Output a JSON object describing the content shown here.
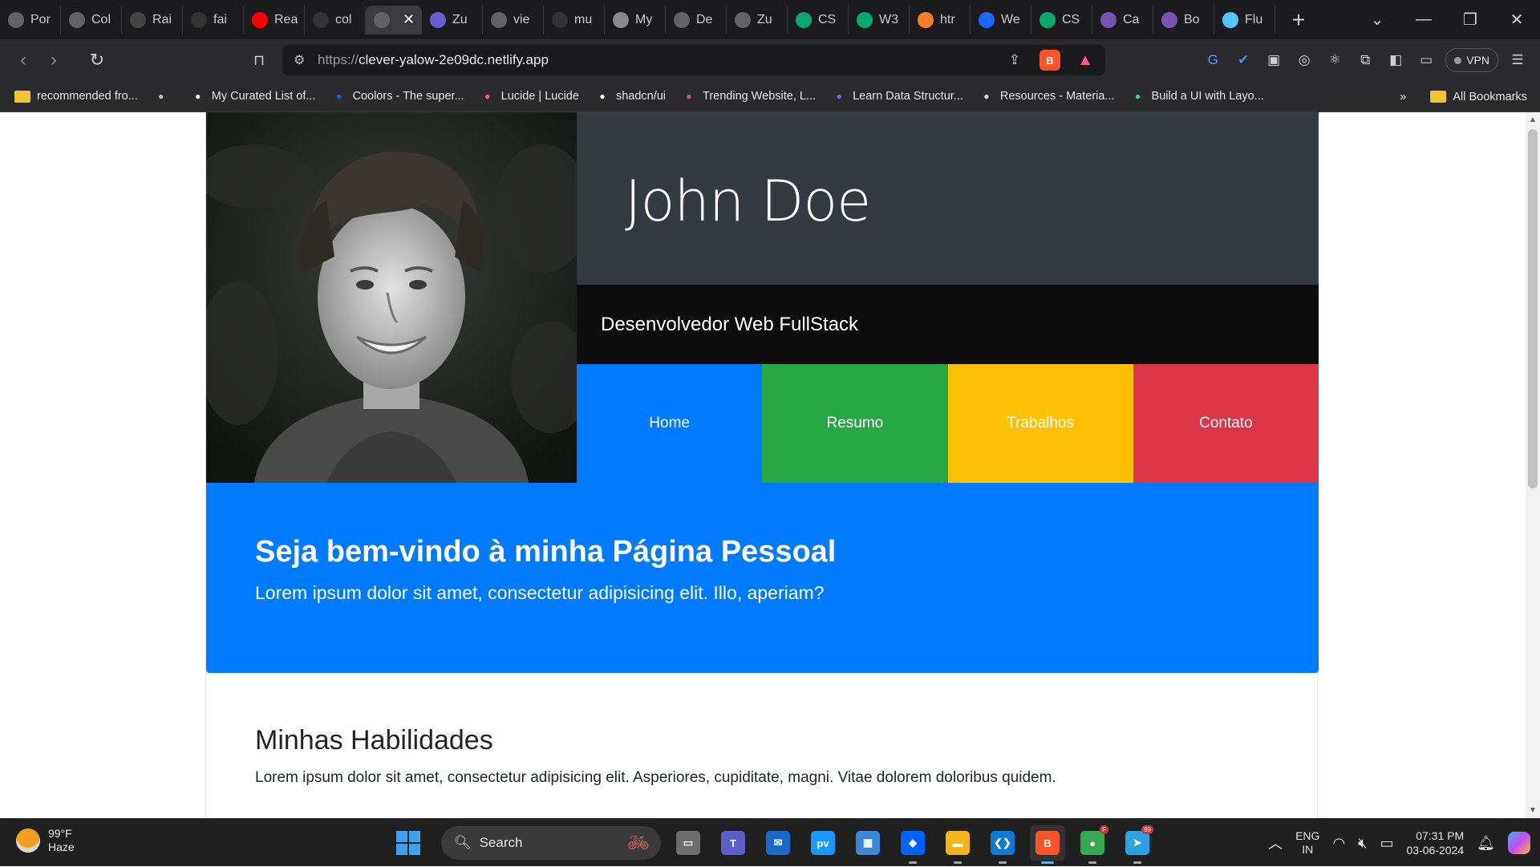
{
  "browser": {
    "tabs": [
      {
        "label": "Por",
        "icon": "globe-icon",
        "color": "#5f6368"
      },
      {
        "label": "Col",
        "icon": "globe-icon",
        "color": "#5f6368"
      },
      {
        "label": "Rai",
        "icon": "openai-icon",
        "color": "#444444"
      },
      {
        "label": "fai",
        "icon": "github-icon",
        "color": "#333333"
      },
      {
        "label": "Rea",
        "icon": "youtube-icon",
        "color": "#ff0000"
      },
      {
        "label": "col",
        "icon": "github-icon",
        "color": "#333333"
      },
      {
        "label": "",
        "icon": "globe-icon",
        "color": "#5f6368",
        "active": true
      },
      {
        "label": "Zu",
        "icon": "zustand-icon",
        "color": "#6b5bd2"
      },
      {
        "label": "vie",
        "icon": "globe-icon",
        "color": "#5f6368"
      },
      {
        "label": "mu",
        "icon": "github-icon",
        "color": "#333333"
      },
      {
        "label": "My",
        "icon": "notion-icon",
        "color": "#888888"
      },
      {
        "label": "De",
        "icon": "globe-icon",
        "color": "#5f6368"
      },
      {
        "label": "Zu",
        "icon": "globe-icon",
        "color": "#5f6368"
      },
      {
        "label": "CS",
        "icon": "w3schools-icon",
        "color": "#04aa6d"
      },
      {
        "label": "W3",
        "icon": "w3schools-icon",
        "color": "#04aa6d"
      },
      {
        "label": "htr",
        "icon": "stackoverflow-icon",
        "color": "#f48024"
      },
      {
        "label": "We",
        "icon": "behance-icon",
        "color": "#1769ff"
      },
      {
        "label": "CS",
        "icon": "w3schools-icon",
        "color": "#04aa6d"
      },
      {
        "label": "Ca",
        "icon": "bootstrap-icon",
        "color": "#7952b3"
      },
      {
        "label": "Bo",
        "icon": "bootstrap-icon",
        "color": "#7952b3"
      },
      {
        "label": "Flu",
        "icon": "flutter-icon",
        "color": "#54c5f8"
      }
    ],
    "url_scheme": "https://",
    "url_host": "clever-yalow-2e09dc.netlify.app",
    "vpn_label": "VPN",
    "bookmarks": [
      {
        "label": "recommended fro...",
        "icon": "folder-icon"
      },
      {
        "label": "",
        "icon": "globe-icon"
      },
      {
        "label": "My Curated List of...",
        "icon": "medium-icon"
      },
      {
        "label": "Coolors - The super...",
        "icon": "coolors-icon"
      },
      {
        "label": "Lucide | Lucide",
        "icon": "lucide-icon"
      },
      {
        "label": "shadcn/ui",
        "icon": "shadcn-icon"
      },
      {
        "label": "Trending Website, L...",
        "icon": "dribbble-icon"
      },
      {
        "label": "Learn Data Structur...",
        "icon": "bookmark-icon"
      },
      {
        "label": "Resources - Materia...",
        "icon": "page-icon"
      },
      {
        "label": "Build a UI with Layo...",
        "icon": "android-icon"
      }
    ],
    "bookmarks_overflow": "»",
    "all_bookmarks": "All Bookmarks"
  },
  "page": {
    "name": "John Doe",
    "role": "Desenvolvedor Web FullStack",
    "menu": [
      {
        "label": "Home",
        "color": "#007bff"
      },
      {
        "label": "Resumo",
        "color": "#28a745"
      },
      {
        "label": "Trabalhos",
        "color": "#ffc107"
      },
      {
        "label": "Contato",
        "color": "#dc3545"
      }
    ],
    "jumbotron": {
      "title": "Seja bem-vindo à minha Página Pessoal",
      "text": "Lorem ipsum dolor sit amet, consectetur adipisicing elit. Illo, aperiam?"
    },
    "skills": {
      "title": "Minhas Habilidades",
      "text": "Lorem ipsum dolor sit amet, consectetur adipisicing elit. Asperiores, cupiditate, magni. Vitae dolorem doloribus quidem."
    }
  },
  "taskbar": {
    "weather_temp": "99°F",
    "weather_desc": "Haze",
    "search_label": "Search",
    "apps": [
      {
        "name": "task-view",
        "color": "#6d6d6d",
        "glyph": "▭"
      },
      {
        "name": "teams",
        "color": "#5b5fc7",
        "glyph": "T"
      },
      {
        "name": "mail",
        "color": "#1b6ac9",
        "glyph": "✉"
      },
      {
        "name": "prime-video",
        "color": "#1a98ff",
        "glyph": "pv"
      },
      {
        "name": "microsoft-store",
        "color": "#3a86d8",
        "glyph": "▦"
      },
      {
        "name": "dropbox",
        "color": "#0061fe",
        "glyph": "◆"
      },
      {
        "name": "file-explorer",
        "color": "#f3b51b",
        "glyph": "▬"
      },
      {
        "name": "vscode",
        "color": "#0e7ad3",
        "glyph": "❮❯"
      },
      {
        "name": "brave",
        "color": "#fb542b",
        "glyph": "B",
        "active": true
      },
      {
        "name": "chrome",
        "color": "#34a853",
        "glyph": "●",
        "badge": "F"
      },
      {
        "name": "telegram",
        "color": "#2aa3df",
        "glyph": "➤",
        "badge": "99"
      }
    ],
    "lang_line1": "ENG",
    "lang_line2": "IN",
    "time": "07:31 PM",
    "date": "03-06-2024"
  }
}
